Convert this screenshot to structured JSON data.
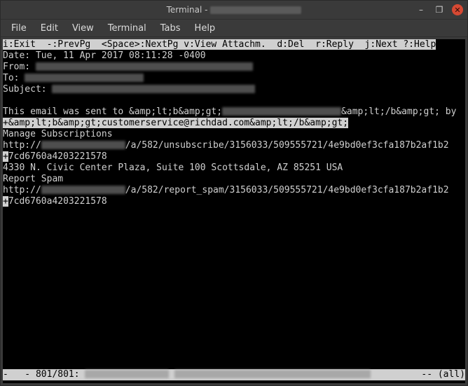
{
  "window": {
    "title_prefix": "Terminal - "
  },
  "menubar": {
    "items": [
      "File",
      "Edit",
      "View",
      "Terminal",
      "Tabs",
      "Help"
    ]
  },
  "keybar": {
    "text": "i:Exit  -:PrevPg  <Space>:NextPg v:View Attachm.  d:Del  r:Reply  j:Next ?:Help"
  },
  "headers": {
    "date_label": "Date: ",
    "date_value": "Tue, 11 Apr 2017 08:11:28 -0400",
    "from_label": "From: ",
    "to_label": "To: ",
    "subject_label": "Subject: "
  },
  "body": {
    "l1a": "This email was sent to &amp;lt;b&amp;gt;",
    "l1b": "&amp;lt;/b&amp;gt; by",
    "l2": "+&amp;lt;b&amp;gt;customerservice@richdad.com&amp;lt;/b&amp;gt;",
    "l3": "Manage Subscriptions",
    "l4a": "http://",
    "l4b": "/a/582/unsubscribe/3156033/509555721/4e9bd0ef3cfa187b2af1b2",
    "l5a": "+",
    "l5b": "7cd6760a4203221578",
    "l6": "4330 N. Civic Center Plaza, Suite 100 Scottsdale, AZ 85251 USA",
    "l7": "Report Spam",
    "l8a": "http://",
    "l8b": "/a/582/report_spam/3156033/509555721/4e9bd0ef3cfa187b2af1b2",
    "l9a": "+",
    "l9b": "7cd6760a4203221578"
  },
  "status": {
    "left1": "-   - ",
    "count": "801/801: ",
    "right": " -- (all)"
  }
}
